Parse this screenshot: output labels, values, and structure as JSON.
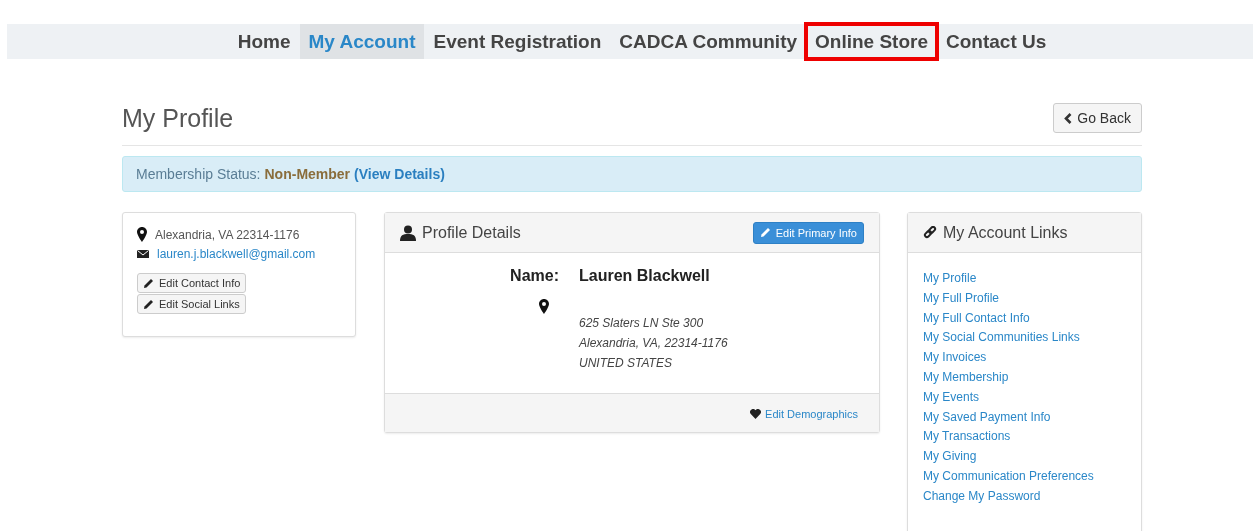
{
  "nav": [
    {
      "label": "Home",
      "selected": false,
      "highlighted": false
    },
    {
      "label": "My Account",
      "selected": true,
      "highlighted": false
    },
    {
      "label": "Event Registration",
      "selected": false,
      "highlighted": false
    },
    {
      "label": "CADCA Community",
      "selected": false,
      "highlighted": false
    },
    {
      "label": "Online Store",
      "selected": false,
      "highlighted": true
    },
    {
      "label": "Contact Us",
      "selected": false,
      "highlighted": false
    }
  ],
  "page_title": "My Profile",
  "back_button": "Go Back",
  "membership": {
    "label": "Membership Status:",
    "status": "Non-Member",
    "link": "(View Details)"
  },
  "contact_card": {
    "location": "Alexandria, VA 22314-1176",
    "email": "lauren.j.blackwell@gmail.com",
    "buttons": [
      "Edit Contact Info",
      "Edit Social Links"
    ]
  },
  "profile_details": {
    "title": "Profile Details",
    "edit_button": "Edit Primary Info",
    "name_label": "Name:",
    "name": "Lauren Blackwell",
    "address": [
      "625 Slaters LN Ste 300",
      "Alexandria, VA, 22314-1176",
      "UNITED STATES"
    ],
    "footer_link": "Edit Demographics"
  },
  "account_links": {
    "title": "My Account Links",
    "links": [
      "My Profile",
      "My Full Profile",
      "My Full Contact Info",
      "My Social Communities Links",
      "My Invoices",
      "My Membership",
      "My Events",
      "My Saved Payment Info",
      "My Transactions",
      "My Giving",
      "My Communication Preferences",
      "Change My Password"
    ]
  }
}
